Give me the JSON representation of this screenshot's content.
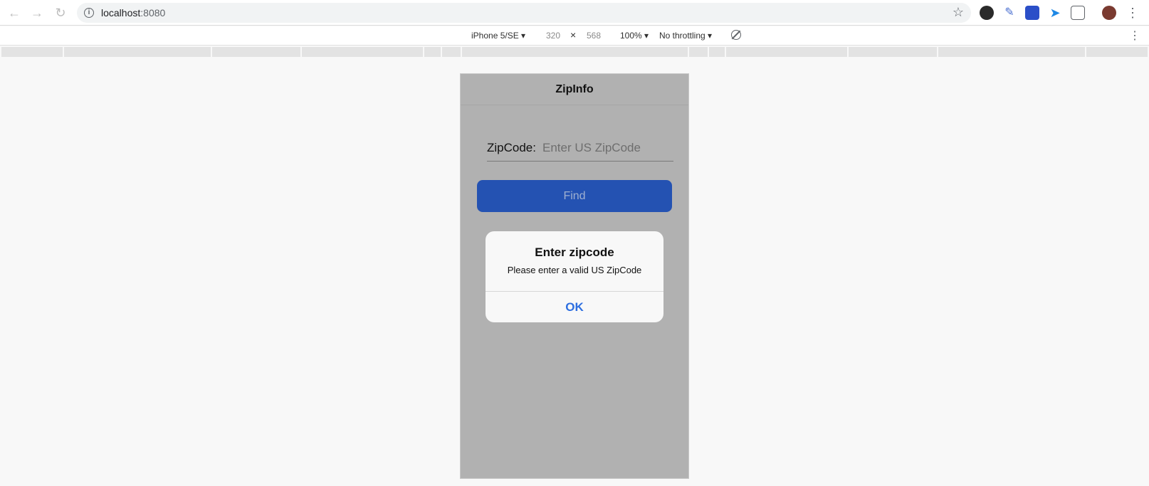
{
  "browser": {
    "url_host": "localhost",
    "url_port": ":8080"
  },
  "device_toolbar": {
    "device": "iPhone 5/SE",
    "width": "320",
    "times": "×",
    "height": "568",
    "zoom": "100%",
    "throttling": "No throttling"
  },
  "app": {
    "title": "ZipInfo",
    "zip_label": "ZipCode:",
    "zip_placeholder": "Enter US ZipCode",
    "find_label": "Find"
  },
  "alert": {
    "title": "Enter zipcode",
    "message": "Please enter a valid US ZipCode",
    "ok_label": "OK"
  }
}
